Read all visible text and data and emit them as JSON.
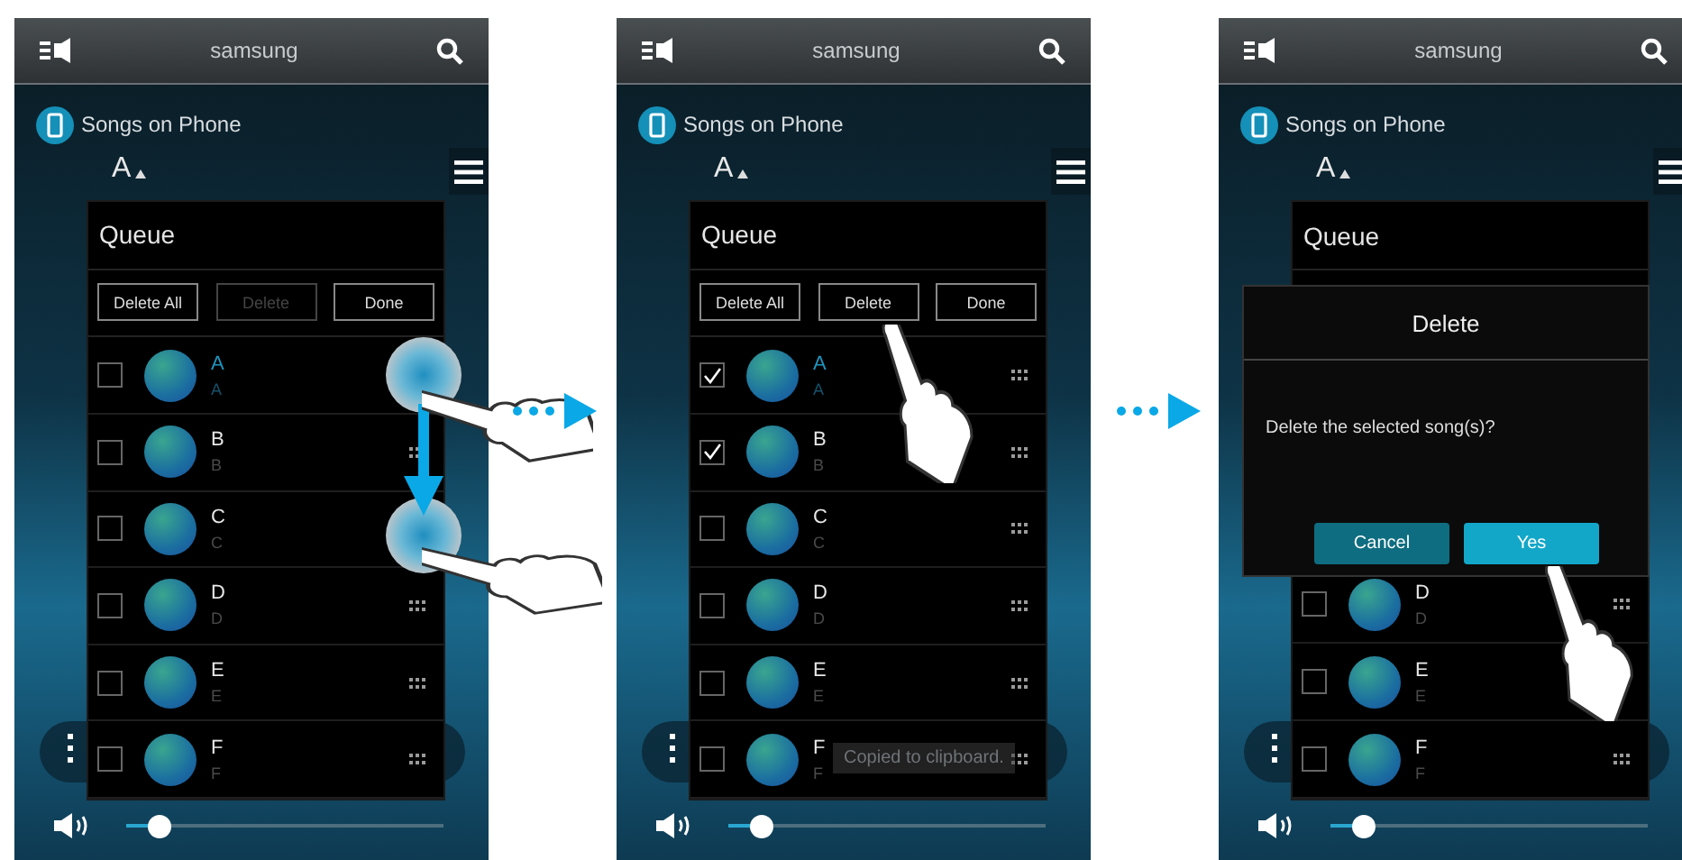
{
  "panels": [
    {
      "header": {
        "title": "samsung"
      },
      "source": "Songs on Phone",
      "sort": "A",
      "queue": {
        "title": "Queue",
        "buttons": [
          {
            "label": "Delete All",
            "disabled": false
          },
          {
            "label": "Delete",
            "disabled": true
          },
          {
            "label": "Done",
            "disabled": false
          }
        ],
        "songs": [
          {
            "title": "A",
            "artist": "A",
            "checked": false,
            "playing": true
          },
          {
            "title": "B",
            "artist": "B",
            "checked": false,
            "playing": false
          },
          {
            "title": "C",
            "artist": "C",
            "checked": false,
            "playing": false
          },
          {
            "title": "D",
            "artist": "D",
            "checked": false,
            "playing": false
          },
          {
            "title": "E",
            "artist": "E",
            "checked": false,
            "playing": false
          },
          {
            "title": "F",
            "artist": "F",
            "checked": false,
            "playing": false
          }
        ]
      },
      "volume": {
        "level": 0.1
      },
      "gesture": {
        "kind": "drag"
      }
    },
    {
      "header": {
        "title": "samsung"
      },
      "source": "Songs on Phone",
      "sort": "A",
      "queue": {
        "title": "Queue",
        "buttons": [
          {
            "label": "Delete All",
            "disabled": false
          },
          {
            "label": "Delete",
            "disabled": false
          },
          {
            "label": "Done",
            "disabled": false
          }
        ],
        "songs": [
          {
            "title": "A",
            "artist": "A",
            "checked": true,
            "playing": true
          },
          {
            "title": "B",
            "artist": "B",
            "checked": true,
            "playing": false
          },
          {
            "title": "C",
            "artist": "C",
            "checked": false,
            "playing": false
          },
          {
            "title": "D",
            "artist": "D",
            "checked": false,
            "playing": false
          },
          {
            "title": "E",
            "artist": "E",
            "checked": false,
            "playing": false
          },
          {
            "title": "F",
            "artist": "F",
            "checked": false,
            "playing": false
          }
        ]
      },
      "volume": {
        "level": 0.1
      },
      "toast": "Copied to clipboard.",
      "gesture": {
        "kind": "tap-button"
      }
    },
    {
      "header": {
        "title": "samsung"
      },
      "source": "Songs on Phone",
      "sort": "A",
      "queue": {
        "title": "Queue",
        "songs": [
          {
            "title": "D",
            "artist": "D",
            "checked": false,
            "playing": false
          },
          {
            "title": "E",
            "artist": "E",
            "checked": false,
            "playing": false
          },
          {
            "title": "F",
            "artist": "F",
            "checked": false,
            "playing": false
          }
        ]
      },
      "volume": {
        "level": 0.1
      },
      "dialog": {
        "title": "Delete",
        "message": "Delete the selected song(s)?",
        "buttons": [
          {
            "label": "Cancel",
            "kind": "secondary"
          },
          {
            "label": "Yes",
            "kind": "primary"
          }
        ]
      },
      "gesture": {
        "kind": "tap-dialog"
      }
    }
  ]
}
